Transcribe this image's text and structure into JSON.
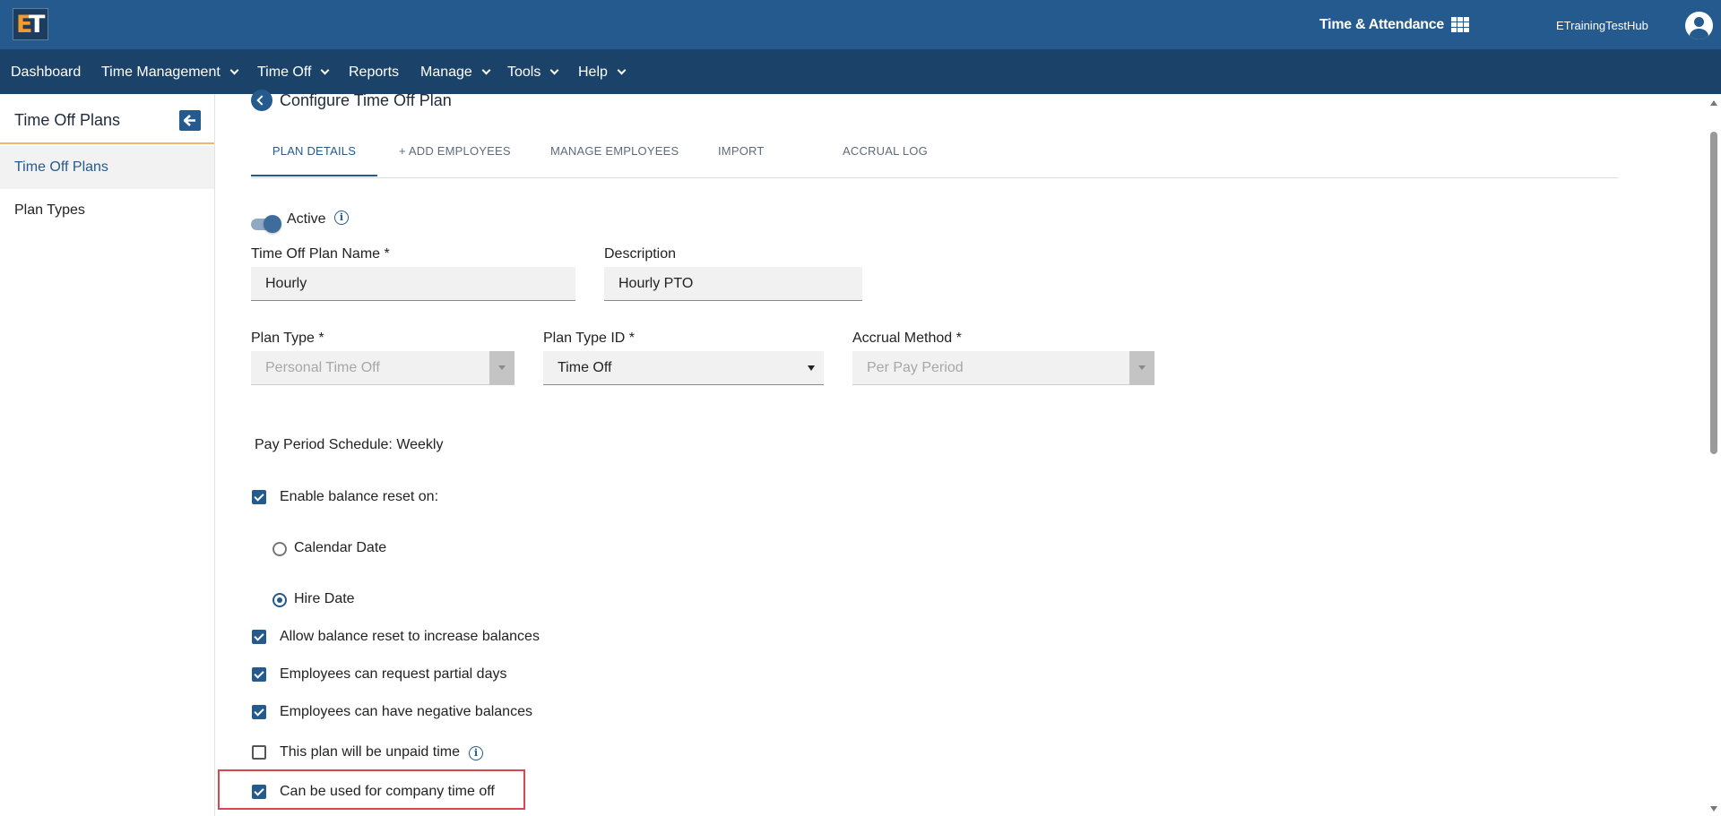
{
  "header": {
    "logo_text": "ET",
    "app_title": "Time & Attendance",
    "org_name": "ETrainingTestHub"
  },
  "nav": {
    "items": [
      {
        "label": "Dashboard",
        "has_menu": false
      },
      {
        "label": "Time Management",
        "has_menu": true
      },
      {
        "label": "Time Off",
        "has_menu": true
      },
      {
        "label": "Reports",
        "has_menu": false
      },
      {
        "label": "Manage",
        "has_menu": true
      },
      {
        "label": "Tools",
        "has_menu": true
      },
      {
        "label": "Help",
        "has_menu": true
      }
    ]
  },
  "sidebar": {
    "title": "Time Off Plans",
    "items": [
      {
        "label": "Time Off Plans",
        "active": true
      },
      {
        "label": "Plan Types",
        "active": false
      }
    ]
  },
  "page": {
    "title": "Configure Time Off Plan",
    "tabs": [
      {
        "label": "Plan Details",
        "active": true
      },
      {
        "label": "+ Add Employees",
        "active": false
      },
      {
        "label": "Manage Employees",
        "active": false
      },
      {
        "label": "Import",
        "active": false
      },
      {
        "label": "Accrual Log",
        "active": false
      }
    ]
  },
  "form": {
    "active_label": "Active",
    "active_on": true,
    "plan_name_label": "Time Off Plan Name *",
    "plan_name_value": "Hourly",
    "description_label": "Description",
    "description_value": "Hourly PTO",
    "plan_type_label": "Plan Type *",
    "plan_type_value": "Personal Time Off",
    "plan_type_id_label": "Plan Type ID *",
    "plan_type_id_value": "Time Off",
    "accrual_method_label": "Accrual Method *",
    "accrual_method_value": "Per Pay Period",
    "pay_period_schedule": "Pay Period Schedule: Weekly",
    "enable_reset_label": "Enable balance reset on:",
    "enable_reset_checked": true,
    "reset_options": [
      {
        "label": "Calendar Date",
        "selected": false
      },
      {
        "label": "Hire Date",
        "selected": true
      }
    ],
    "checkboxes": [
      {
        "label": "Allow balance reset to increase balances",
        "checked": true
      },
      {
        "label": "Employees can request partial days",
        "checked": true
      },
      {
        "label": "Employees can have negative balances",
        "checked": true
      },
      {
        "label": "This plan will be unpaid time",
        "checked": false
      },
      {
        "label": "Can be used for company time off",
        "checked": true
      }
    ],
    "info_glyph": "i"
  },
  "colors": {
    "header_bg": "#245a8e",
    "nav_bg": "#1b4268",
    "accent": "#245a8e",
    "highlight": "#d9464b"
  }
}
